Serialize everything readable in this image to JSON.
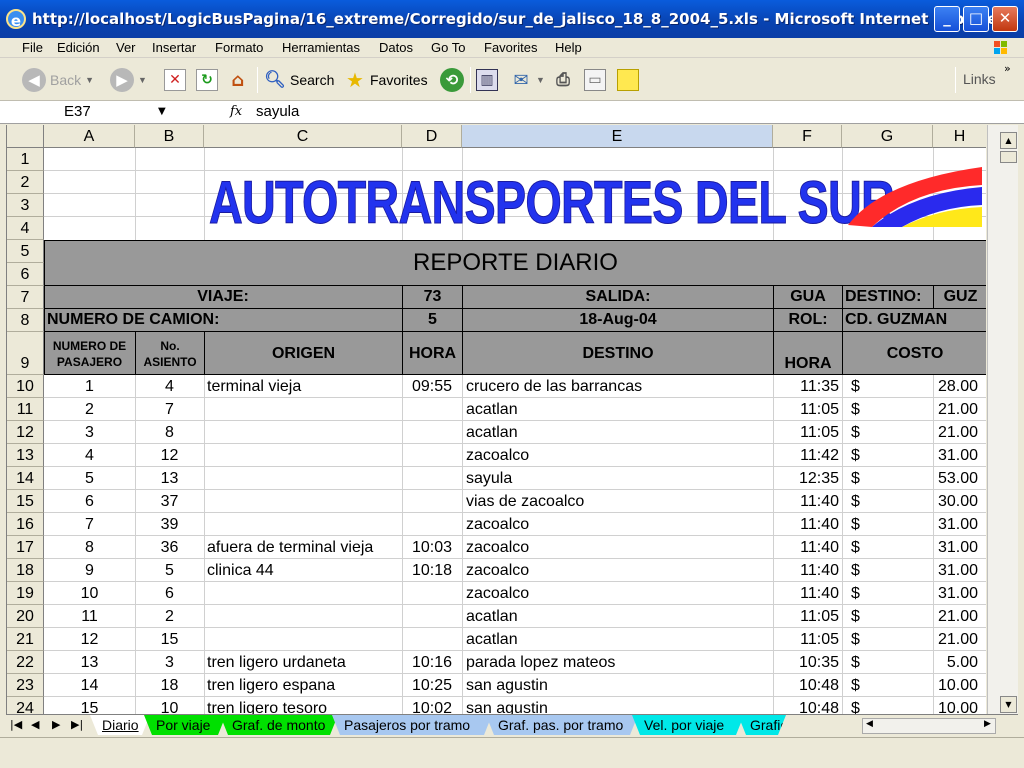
{
  "window": {
    "title": "http://localhost/LogicBusPagina/16_extreme/Corregido/sur_de_jalisco_18_8_2004_5.xls - Microsoft Internet Explorer",
    "minimize": "_",
    "maximize": "□",
    "close": "✕"
  },
  "menu": [
    "File",
    "Edición",
    "Ver",
    "Insertar",
    "Formato",
    "Herramientas",
    "Datos",
    "Go To",
    "Favorites",
    "Help"
  ],
  "toolbar": {
    "back": "Back",
    "search": "Search",
    "favorites": "Favorites",
    "links": "Links"
  },
  "formula_bar": {
    "cell_ref": "E37",
    "fx": "fx",
    "value": "sayula"
  },
  "columns": [
    "A",
    "B",
    "C",
    "D",
    "E",
    "F",
    "G",
    "H"
  ],
  "rows": [
    "1",
    "2",
    "3",
    "4",
    "5",
    "6",
    "7",
    "8",
    "9",
    "10",
    "11",
    "12",
    "13",
    "14",
    "15",
    "16",
    "17",
    "18",
    "19",
    "20",
    "21",
    "22",
    "23",
    "24"
  ],
  "banner": "AUTOTRANSPORTES DEL SUR",
  "report": {
    "title": "REPORTE DIARIO",
    "viaje_label": "VIAJE:",
    "viaje": "73",
    "salida_label": "SALIDA:",
    "salida": "GUA",
    "destino_label": "DESTINO:",
    "destino": "GUZ",
    "camion_label": "NUMERO DE CAMION:",
    "camion": "5",
    "fecha": "18-Aug-04",
    "rol_label": "ROL:",
    "rol": "CD. GUZMAN"
  },
  "headers": {
    "pasajero": "NUMERO DE PASAJERO",
    "asiento": "No. ASIENTO",
    "origen": "ORIGEN",
    "hora": "HORA",
    "destino": "DESTINO",
    "hora2": "HORA",
    "costo": "COSTO"
  },
  "currency": "$",
  "passengers": [
    {
      "n": "1",
      "seat": "4",
      "origin": "terminal vieja",
      "time": "09:55",
      "dest": "crucero de las barrancas",
      "arr": "11:35",
      "cost": "28.00"
    },
    {
      "n": "2",
      "seat": "7",
      "origin": "",
      "time": "",
      "dest": "acatlan",
      "arr": "11:05",
      "cost": "21.00"
    },
    {
      "n": "3",
      "seat": "8",
      "origin": "",
      "time": "",
      "dest": "acatlan",
      "arr": "11:05",
      "cost": "21.00"
    },
    {
      "n": "4",
      "seat": "12",
      "origin": "",
      "time": "",
      "dest": "zacoalco",
      "arr": "11:42",
      "cost": "31.00"
    },
    {
      "n": "5",
      "seat": "13",
      "origin": "",
      "time": "",
      "dest": "sayula",
      "arr": "12:35",
      "cost": "53.00"
    },
    {
      "n": "6",
      "seat": "37",
      "origin": "",
      "time": "",
      "dest": "vias de zacoalco",
      "arr": "11:40",
      "cost": "30.00"
    },
    {
      "n": "7",
      "seat": "39",
      "origin": "",
      "time": "",
      "dest": "zacoalco",
      "arr": "11:40",
      "cost": "31.00"
    },
    {
      "n": "8",
      "seat": "36",
      "origin": "afuera de terminal vieja",
      "time": "10:03",
      "dest": "zacoalco",
      "arr": "11:40",
      "cost": "31.00"
    },
    {
      "n": "9",
      "seat": "5",
      "origin": "clinica 44",
      "time": "10:18",
      "dest": "zacoalco",
      "arr": "11:40",
      "cost": "31.00"
    },
    {
      "n": "10",
      "seat": "6",
      "origin": "",
      "time": "",
      "dest": "zacoalco",
      "arr": "11:40",
      "cost": "31.00"
    },
    {
      "n": "11",
      "seat": "2",
      "origin": "",
      "time": "",
      "dest": "acatlan",
      "arr": "11:05",
      "cost": "21.00"
    },
    {
      "n": "12",
      "seat": "15",
      "origin": "",
      "time": "",
      "dest": "acatlan",
      "arr": "11:05",
      "cost": "21.00"
    },
    {
      "n": "13",
      "seat": "3",
      "origin": "tren ligero urdaneta",
      "time": "10:16",
      "dest": "parada lopez mateos",
      "arr": "10:35",
      "cost": "5.00"
    },
    {
      "n": "14",
      "seat": "18",
      "origin": "tren ligero espana",
      "time": "10:25",
      "dest": "san agustin",
      "arr": "10:48",
      "cost": "10.00"
    },
    {
      "n": "15",
      "seat": "10",
      "origin": "tren ligero tesoro",
      "time": "10:02",
      "dest": "san agustin",
      "arr": "10:48",
      "cost": "10.00"
    }
  ],
  "sheet_tabs": [
    {
      "label": "Diario",
      "color": "#ffffff"
    },
    {
      "label": "Por viaje",
      "color": "#00e000"
    },
    {
      "label": "Graf. de monto",
      "color": "#00e000"
    },
    {
      "label": "Pasajeros por tramo",
      "color": "#a8c8f0"
    },
    {
      "label": "Graf. pas. por tramo",
      "color": "#a8c8f0"
    },
    {
      "label": "Vel. por viaje",
      "color": "#00e8e8"
    },
    {
      "label": "Grafic",
      "color": "#00e8e8"
    }
  ],
  "colors": {
    "header_gray": "#999999",
    "banner_blue": "#2233ee"
  }
}
